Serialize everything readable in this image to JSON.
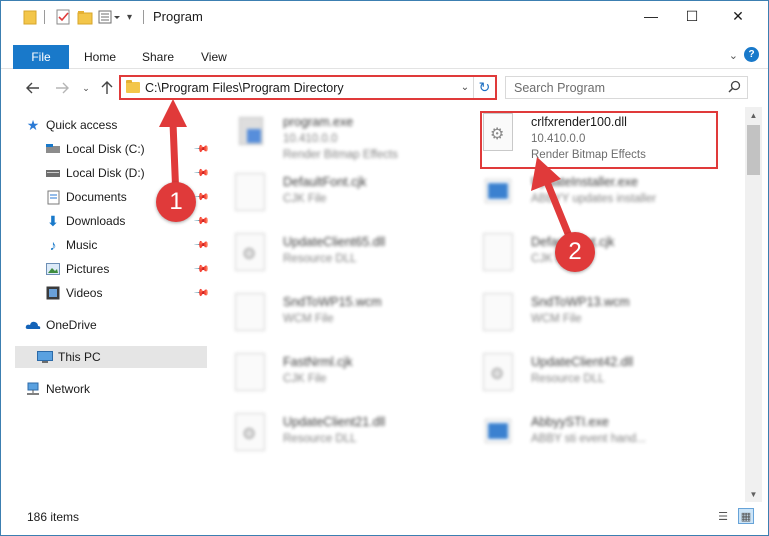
{
  "window": {
    "title": "Program",
    "controls": {
      "minimize": "—",
      "maximize": "☐",
      "close": "✕"
    }
  },
  "ribbon": {
    "file": "File",
    "tabs": [
      "Home",
      "Share",
      "View"
    ]
  },
  "address": {
    "path": "C:\\Program Files\\Program Directory"
  },
  "search": {
    "placeholder": "Search Program"
  },
  "sidebar": {
    "items": [
      {
        "label": "Quick access",
        "icon": "star-icon"
      },
      {
        "label": "Local Disk (C:)",
        "icon": "drive-icon"
      },
      {
        "label": "Local Disk (D:)",
        "icon": "drive-icon"
      },
      {
        "label": "Documents",
        "icon": "documents-icon"
      },
      {
        "label": "Downloads",
        "icon": "download-icon"
      },
      {
        "label": "Music",
        "icon": "music-icon"
      },
      {
        "label": "Pictures",
        "icon": "pictures-icon"
      },
      {
        "label": "Videos",
        "icon": "videos-icon"
      },
      {
        "label": "OneDrive",
        "icon": "cloud-icon"
      },
      {
        "label": "This PC",
        "icon": "computer-icon"
      },
      {
        "label": "Network",
        "icon": "network-icon"
      }
    ]
  },
  "files": [
    {
      "name": "program.exe",
      "line1": "10.410.0.0",
      "line2": "Render Bitmap Effects"
    },
    {
      "name": "crlfxrender100.dll",
      "line1": "10.410.0.0",
      "line2": "Render Bitmap Effects"
    },
    {
      "name": "DefaultFont.cjk",
      "line1": "CJK File",
      "line2": ""
    },
    {
      "name": "UpdateInstaller.exe",
      "line1": "ABBYY updates installer",
      "line2": ""
    },
    {
      "name": "UpdateClient65.dll",
      "line1": "Resource DLL",
      "line2": ""
    },
    {
      "name": "DefaultFont.cjk",
      "line1": "CJK File",
      "line2": ""
    },
    {
      "name": "SndToWP15.wcm",
      "line1": "WCM File",
      "line2": ""
    },
    {
      "name": "SndToWP13.wcm",
      "line1": "WCM File",
      "line2": ""
    },
    {
      "name": "FastNrml.cjk",
      "line1": "CJK File",
      "line2": ""
    },
    {
      "name": "UpdateClient42.dll",
      "line1": "Resource DLL",
      "line2": ""
    },
    {
      "name": "UpdateClient21.dll",
      "line1": "Resource DLL",
      "line2": ""
    },
    {
      "name": "AbbyySTI.exe",
      "line1": "ABBY sti event hand...",
      "line2": ""
    }
  ],
  "status": {
    "count": "186 items"
  },
  "annotations": {
    "badge1": "1",
    "badge2": "2",
    "color": "#e03a3a"
  }
}
